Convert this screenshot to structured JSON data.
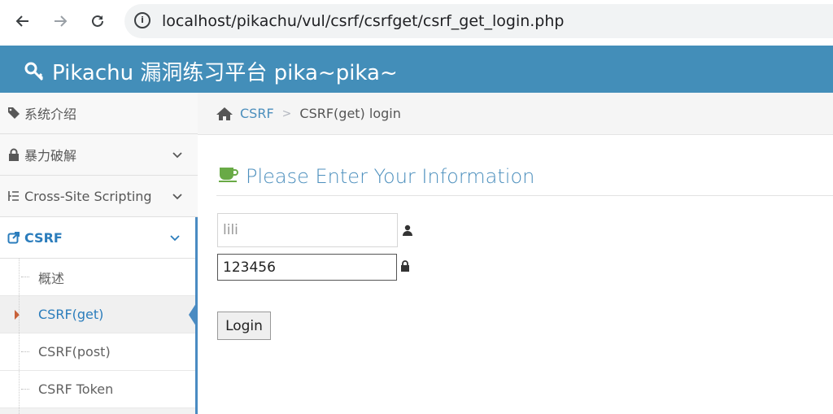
{
  "browser": {
    "url": "localhost/pikachu/vul/csrf/csrfget/csrf_get_login.php",
    "info_glyph": "i"
  },
  "header": {
    "brand_text": "Pikachu 漏洞练习平台 pika~pika~",
    "icon": "key-icon"
  },
  "sidebar": {
    "items": [
      {
        "label": "系统介绍",
        "icon": "tags-icon",
        "expandable": false
      },
      {
        "label": "暴力破解",
        "icon": "lock-icon",
        "expandable": true
      },
      {
        "label": "Cross-Site Scripting",
        "icon": "list-icon",
        "expandable": true
      },
      {
        "label": "CSRF",
        "icon": "share-icon",
        "expandable": true,
        "open": true
      }
    ],
    "sub_items": [
      {
        "label": "概述"
      },
      {
        "label": "CSRF(get)",
        "active": true
      },
      {
        "label": "CSRF(post)"
      },
      {
        "label": "CSRF Token"
      }
    ]
  },
  "breadcrumb": {
    "link": "CSRF",
    "separator": ">",
    "current": "CSRF(get) login"
  },
  "content": {
    "title": "Please Enter Your Information",
    "username_value": "lili",
    "password_value": "123456",
    "login_label": "Login"
  },
  "colors": {
    "header_bg": "#438eb9",
    "link": "#4c8fbd",
    "title_icon": "#69aa46"
  }
}
